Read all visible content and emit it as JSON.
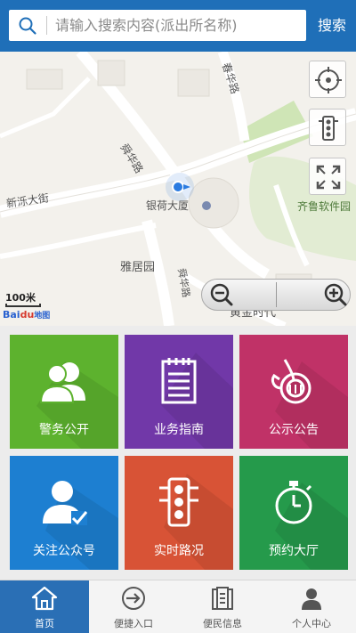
{
  "search": {
    "placeholder": "请输入搜索内容(派出所名称)",
    "button_label": "搜索",
    "icon": "search-icon"
  },
  "map": {
    "labels": {
      "road_top": "春华路",
      "road_mid": "舜华路",
      "street_left": "新泺大街",
      "poi_building": "银荷大厦",
      "poi_software": "齐鲁软件园",
      "poi_garden": "雅居园",
      "road_bottom": "舜华路",
      "poi_golden": "黄金时代"
    },
    "scale_text": "100米",
    "logo_text": "Bai",
    "logo_text2": "du",
    "logo_text3": "地图",
    "controls": [
      "locate-icon",
      "traffic-light-icon",
      "fullscreen-icon",
      "zoom-out-icon",
      "zoom-in-icon"
    ]
  },
  "tiles": [
    {
      "label": "警务公开",
      "color": "#5db22e",
      "icon": "users-icon"
    },
    {
      "label": "业务指南",
      "color": "#7138a8",
      "icon": "notepad-icon"
    },
    {
      "label": "公示公告",
      "color": "#c03267",
      "icon": "horn-icon"
    },
    {
      "label": "关注公众号",
      "color": "#1d7fd1",
      "icon": "user-check-icon"
    },
    {
      "label": "实时路况",
      "color": "#d85336",
      "icon": "traffic-light-icon"
    },
    {
      "label": "预约大厅",
      "color": "#259a4b",
      "icon": "stopwatch-icon"
    }
  ],
  "nav": [
    {
      "label": "首页",
      "icon": "home-icon",
      "active": true
    },
    {
      "label": "便捷入口",
      "icon": "enter-icon",
      "active": false
    },
    {
      "label": "便民信息",
      "icon": "document-icon",
      "active": false
    },
    {
      "label": "个人中心",
      "icon": "person-icon",
      "active": false
    }
  ]
}
